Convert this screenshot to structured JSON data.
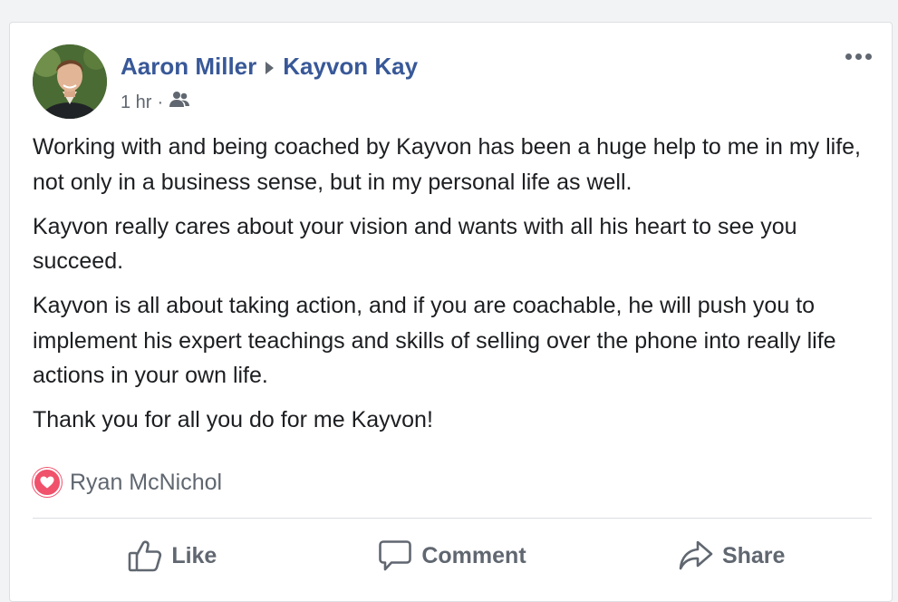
{
  "post": {
    "author": "Aaron Miller",
    "target": "Kayvon Kay",
    "time": "1 hr",
    "separator": "·",
    "audience_icon": "friends-icon",
    "more_icon": "more-options-icon",
    "paragraphs": [
      "Working with and being coached by Kayvon has been a huge help to me in my life, not only in a business sense, but in my personal life as well.",
      "Kayvon really cares about your vision and wants with all his heart to see you succeed.",
      "Kayvon is all about taking action, and if you are coachable, he will push you to implement his expert teachings and skills of selling over the phone into really life actions in your own life.",
      "Thank you for all you do for me Kayvon!"
    ]
  },
  "reactions": {
    "icon": "heart-icon",
    "names": "Ryan McNichol",
    "color": "#f0516b"
  },
  "actions": {
    "like_label": "Like",
    "comment_label": "Comment",
    "share_label": "Share"
  },
  "colors": {
    "link": "#385898",
    "secondary_text": "#606770",
    "primary_text": "#1c1e21",
    "divider": "#dadde1"
  }
}
